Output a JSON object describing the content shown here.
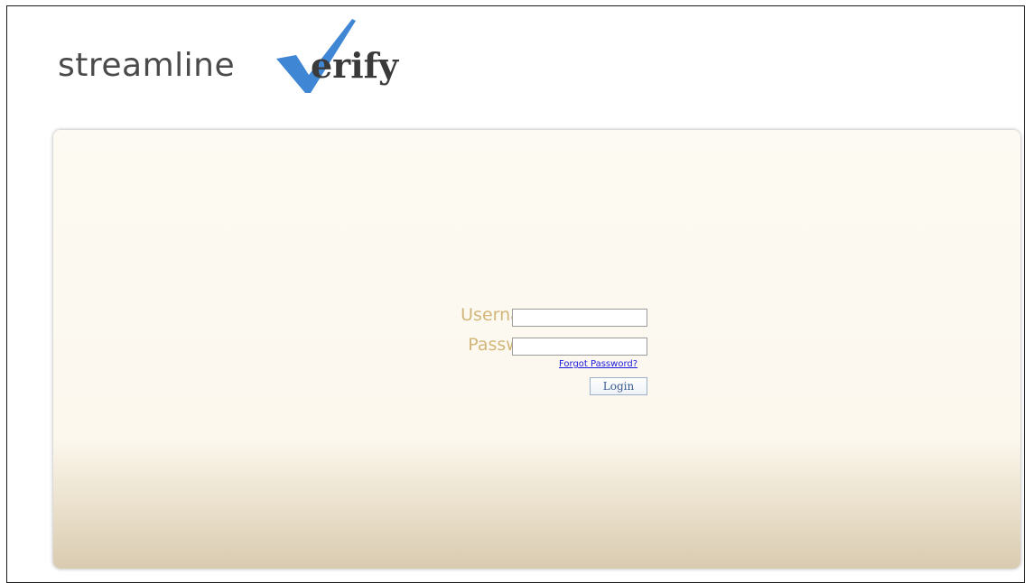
{
  "logo": {
    "text_light": "streamline",
    "text_bold": "erify",
    "icon": "checkmark-icon",
    "check_color": "#3f86d4",
    "text_color": "#4a4a4a"
  },
  "login_form": {
    "username_label": "Username",
    "username_value": "",
    "password_label": "Password",
    "password_value": "",
    "forgot_password_label": "Forgot Password?",
    "login_button_label": "Login"
  },
  "colors": {
    "label": "#d2b67a",
    "link": "#1a1ae0",
    "button_text": "#3c5a8c",
    "panel_top": "#fdfaf3",
    "panel_bottom": "#d9cbb0"
  }
}
